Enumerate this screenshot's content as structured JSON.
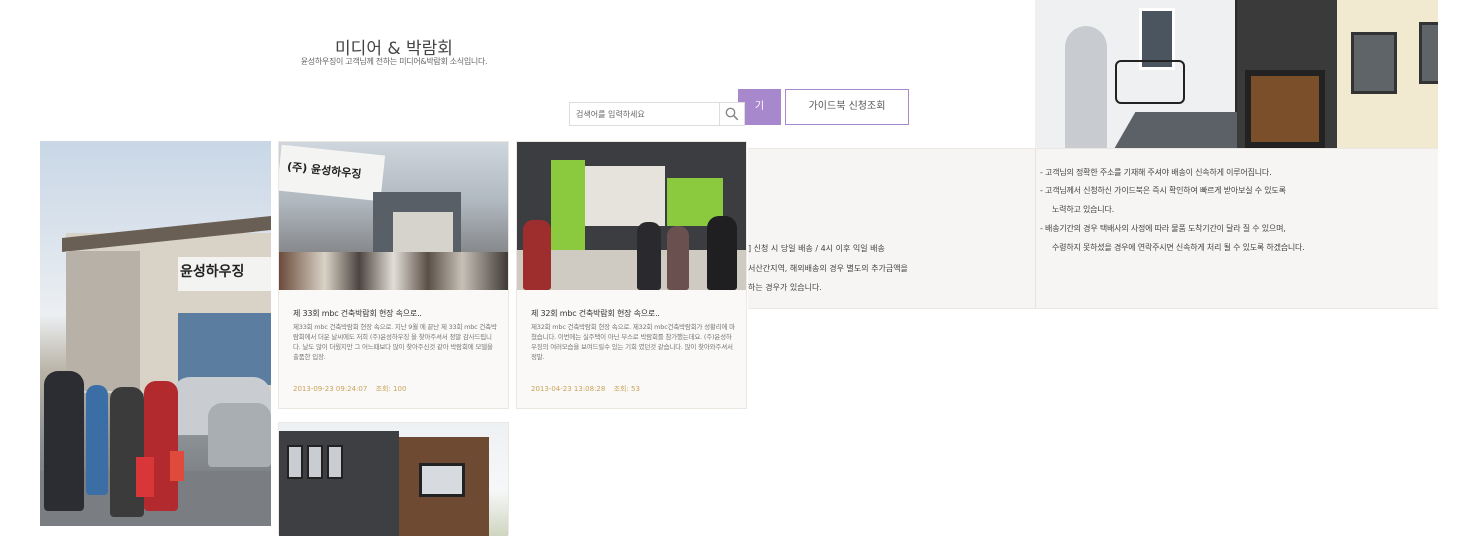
{
  "header": {
    "title": "미디어 & 박람회",
    "subtitle": "윤성하우징이 고객님께 전하는 미디어&박람회 소식입니다."
  },
  "buttons": {
    "purple_label": "기",
    "guide_label": "가이드북 신청조회"
  },
  "search": {
    "placeholder": "검색어를 입력하세요",
    "icon": "search-icon"
  },
  "info": {
    "left_lines": [
      "] 신청 시 당일 배송 / 4시 이후 익일 배송",
      "서산간지역, 해외배송의 경우 별도의 추가금액을",
      "하는 경우가 있습니다."
    ],
    "right_lines": [
      "- 고객님의 정확한 주소를 기재해 주셔야 배송이 신속하게 이루어집니다.",
      "- 고객님께서 신청하신 가이드북은 즉시 확인하여 빠르게 받아보실 수 있도록",
      "노력하고 있습니다.",
      "- 배송기간의 경우 택배사의 사정에 따라 물품 도착기간이 달라 질 수 있으며,",
      "수령하지 못하셨을 경우에 연락주시면 신속하게 처리 될 수 있도록 하겠습니다."
    ]
  },
  "photo_signs": {
    "big_photo_sign": "윤성하우징",
    "card1_banner": "(주) 윤성하우징"
  },
  "cards": [
    {
      "title": "제 33회 mbc 건축박람회 현장 속으로..",
      "body": "제33회 mbc 건축박람회 현장 속으로. 지난 9월 에 끝난 제 33회 mbc 건축박람회에서 더운 날씨에도 저희 (주)윤성하우징 을 찾아주셔서 정말 감사드립니다. 날도 많이 더웠지만 그 어느때보다 많이 찾아주신것 같아 박람회에 모델을 출품한 입장.",
      "date": "2013-09-23 09:24:07",
      "views": "조회: 100"
    },
    {
      "title": "제 32회 mbc 건축박람회 현장 속으로..",
      "body": "제32회 mbc 건축박람회 현장 속으로. 제32회 mbc건축박람회가 성황리에 마쳤습니다. 이번에는 실주택이 아닌 부스로 박람회를 참가했는데요. (주)윤성하우징의 여러모습을 보여드릴수 있는 기회 였던것 같습니다. 많이 찾아와주셔서 정말.",
      "date": "2013-04-23 13:08:28",
      "views": "조회: 53"
    }
  ],
  "colors": {
    "accent_purple": "#a888cd",
    "meta_gold": "#c8a35a",
    "panel_bg": "#f7f5f3"
  }
}
